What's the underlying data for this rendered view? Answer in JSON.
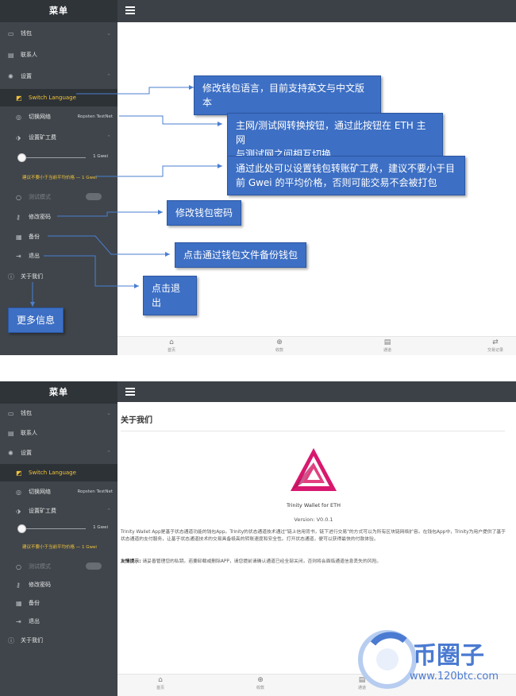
{
  "sidebar": {
    "header": "菜单",
    "items": {
      "wallet": "钱包",
      "contacts": "联系人",
      "settings": "设置",
      "language": "Switch Language",
      "network": "切换网络",
      "network_value": "Ropsten TestNet",
      "mining_fee": "设置矿工费",
      "fee_value": "1 Gwei",
      "fee_warning": "建议不要小于当前平均价格 — 1 Gwei",
      "test_mode": "测试模式",
      "change_password": "修改密码",
      "backup": "备份",
      "logout": "退出",
      "about": "关于我们"
    }
  },
  "tabs": {
    "home": "首页",
    "receive": "收款",
    "channel": "通道",
    "history": "交易记录"
  },
  "annotations": {
    "language": "修改钱包语言，目前支持英文与中文版本",
    "network_1": "主网/测试网转换按钮，通过此按钮在 ETH 主网",
    "network_2": "与测试网之间相互切换",
    "fee_1": "通过此处可以设置钱包转账矿工费，建议不要小于目",
    "fee_2": "前 Gwei 的平均价格，否则可能交易不会被打包",
    "password": "修改钱包密码",
    "backup": "点击通过钱包文件备份钱包",
    "logout": "点击退出",
    "more_info": "更多信息"
  },
  "about": {
    "title": "关于我们",
    "app_name": "Trinity Wallet for ETH",
    "version": "Version: V0.0.1",
    "description": "Trinity Wallet App是基于状态通道功能的钱包App。Trinity的状态通道技术通过\"链上信用背书，链下进行交易\"的方式可以为所有区块链网络扩容。在钱包App中，Trinity为用户提供了基于状态通道的支付服务，让基于状态通道技术的交易具备极高的转账速度和安全性。打开状态通道，便可以获得最快的付款体验。",
    "tip_label": "友情提示:",
    "tip_text": " 请妥善管理您的私钥。若要卸载或删除APP，请您提前请确认通道已经全部关闭，否则将会面临通道信息丢失的风险。"
  },
  "watermark": {
    "brand": "币圈子",
    "url": "www.120btc.com"
  },
  "colors": {
    "sidebar_bg": "#3f454b",
    "active_text": "#f3c33a",
    "callout_blue": "#3d6fc4",
    "logo_pink": "#d8186e"
  }
}
